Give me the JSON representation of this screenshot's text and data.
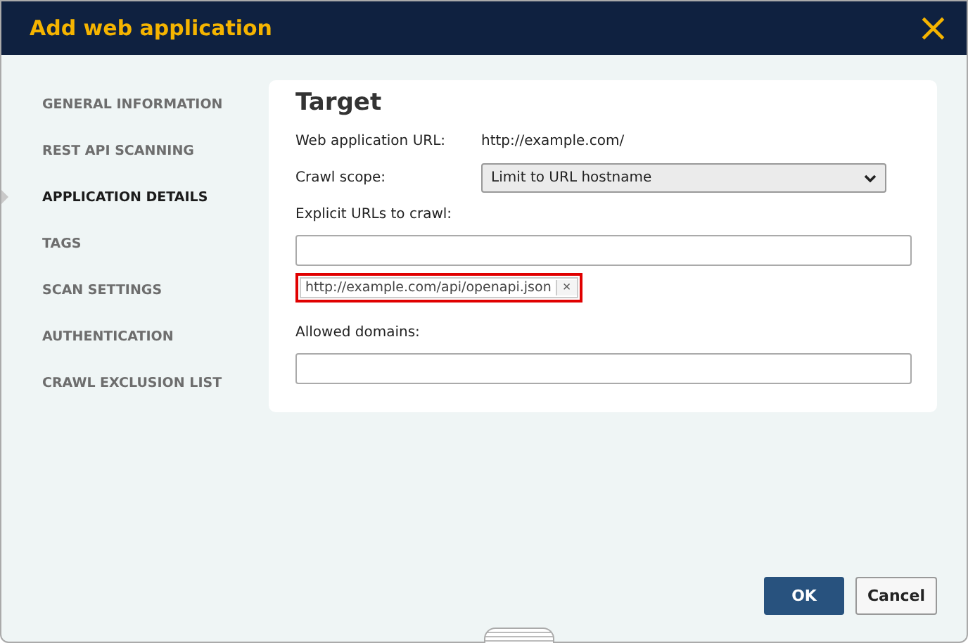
{
  "window": {
    "title": "Add web application",
    "close": "×"
  },
  "sidebar": {
    "items": [
      {
        "label": "GENERAL INFORMATION",
        "selected": false
      },
      {
        "label": "REST API SCANNING",
        "selected": false
      },
      {
        "label": "APPLICATION DETAILS",
        "selected": true
      },
      {
        "label": "TAGS",
        "selected": false
      },
      {
        "label": "SCAN SETTINGS",
        "selected": false
      },
      {
        "label": "AUTHENTICATION",
        "selected": false
      },
      {
        "label": "CRAWL EXCLUSION LIST",
        "selected": false
      }
    ]
  },
  "section": {
    "title": "Target",
    "web_app_url": {
      "label": "Web application URL:",
      "value": "http://example.com/"
    },
    "crawl_scope": {
      "label": "Crawl scope:",
      "value": "Limit to URL hostname"
    },
    "explicit_urls": {
      "label": "Explicit URLs to crawl:",
      "tags": [
        {
          "text": "http://example.com/api/openapi.json",
          "remove": "×",
          "highlighted": true
        }
      ]
    },
    "allowed_domains": {
      "label": "Allowed domains:"
    }
  },
  "buttons": [
    {
      "label": "OK",
      "kind": "primary"
    },
    {
      "label": "Cancel",
      "kind": "secondary"
    }
  ]
}
